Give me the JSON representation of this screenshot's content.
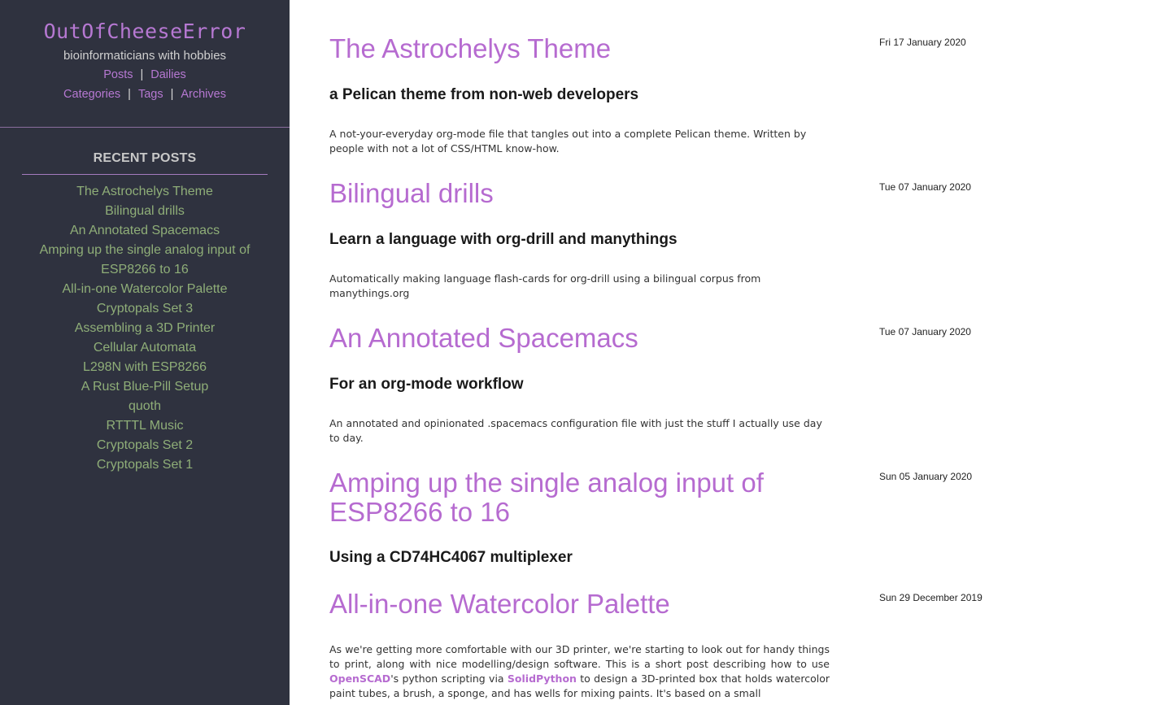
{
  "site": {
    "title": "OutOfCheeseError",
    "tagline": "bioinformaticians with hobbies"
  },
  "nav": {
    "posts": "Posts",
    "dailies": "Dailies",
    "categories": "Categories",
    "tags": "Tags",
    "archives": "Archives",
    "separator": "|"
  },
  "sidebar": {
    "recent_heading": "RECENT POSTS",
    "recent_posts": [
      "The Astrochelys Theme",
      "Bilingual drills",
      "An Annotated Spacemacs",
      "Amping up the single analog input of ESP8266 to 16",
      "All-in-one Watercolor Palette",
      "Cryptopals Set 3",
      "Assembling a 3D Printer",
      "Cellular Automata",
      "L298N with ESP8266",
      "A Rust Blue-Pill Setup",
      "quoth",
      "RTTTL Music",
      "Cryptopals Set 2",
      "Cryptopals Set 1"
    ]
  },
  "posts": [
    {
      "title": "The Astrochelys Theme",
      "date": "Fri 17 January 2020",
      "subtitle": "a Pelican theme from non-web developers",
      "summary": "A not-your-everyday org-mode file that tangles out into a complete Pelican theme. Written by people with not a lot of CSS/HTML know-how."
    },
    {
      "title": "Bilingual drills",
      "date": "Tue 07 January 2020",
      "subtitle": "Learn a language with org-drill and manythings",
      "summary": "Automatically making language flash-cards for org-drill using a bilingual corpus from manythings.org"
    },
    {
      "title": "An Annotated Spacemacs",
      "date": "Tue 07 January 2020",
      "subtitle": "For an org-mode workflow",
      "summary": "An annotated and opinionated .spacemacs configuration file with just the stuff I actually use day to day."
    },
    {
      "title": "Amping up the single analog input of ESP8266 to 16",
      "date": "Sun 05 January 2020",
      "subtitle": "Using a CD74HC4067 multiplexer"
    },
    {
      "title": "All-in-one Watercolor Palette",
      "date": "Sun 29 December 2019",
      "summary_parts": {
        "p1": "As we're getting more comfortable with our 3D printer, we're starting to look out for handy things to print, along with nice modelling/design software. This is a short post describing how to use ",
        "link1": "OpenSCAD",
        "p2": "'s python scripting via ",
        "link2": "SolidPython",
        "p3": " to design a 3D-printed box that holds watercolor paint tubes, a brush, a sponge, and has wells for mixing paints. It's based on a small"
      }
    }
  ]
}
